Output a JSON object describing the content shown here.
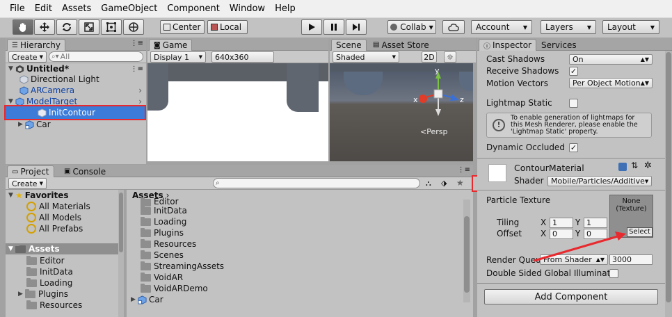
{
  "menu": [
    "File",
    "Edit",
    "Assets",
    "GameObject",
    "Component",
    "Window",
    "Help"
  ],
  "toolbar": {
    "pivot": "Center",
    "space": "Local",
    "collab": "Collab",
    "account": "Account",
    "layers": "Layers",
    "layout": "Layout"
  },
  "hierarchy": {
    "tab": "Hierarchy",
    "create": "Create",
    "search_placeholder": "All",
    "scene": "Untitled*",
    "items": [
      "Directional Light",
      "ARCamera",
      "ModelTarget",
      "InitContour",
      "Car"
    ]
  },
  "game": {
    "tab": "Game",
    "display": "Display 1",
    "resolution": "640x360"
  },
  "scene_view": {
    "tab": "Scene",
    "asset_store": "Asset Store",
    "shading": "Shaded",
    "mode2d": "2D",
    "persp": "Persp",
    "axes": [
      "y",
      "x",
      "z"
    ]
  },
  "project": {
    "tab": "Project",
    "console": "Console",
    "create": "Create",
    "favorites": "Favorites",
    "favorite_items": [
      "All Materials",
      "All Models",
      "All Prefabs"
    ],
    "assets": "Assets",
    "asset_folders": [
      "Editor",
      "InitData",
      "Loading",
      "Plugins",
      "Resources"
    ],
    "breadcrumb": "Assets",
    "files": [
      "Editor",
      "InitData",
      "Loading",
      "Plugins",
      "Resources",
      "Scenes",
      "StreamingAssets",
      "VoidAR",
      "VoidARDemo",
      "Car"
    ]
  },
  "inspector": {
    "tab": "Inspector",
    "services": "Services",
    "cast_shadows_label": "Cast Shadows",
    "cast_shadows_value": "On",
    "receive_shadows": "Receive Shadows",
    "motion_vectors_label": "Motion Vectors",
    "motion_vectors_value": "Per Object Motion",
    "lightmap_static": "Lightmap Static",
    "lightmap_info": "To enable generation of lightmaps for this Mesh Renderer, please enable the 'Lightmap Static' property.",
    "dynamic_occluded": "Dynamic Occluded",
    "material_name": "ContourMaterial",
    "shader_label": "Shader",
    "shader_value": "Mobile/Particles/Additive",
    "particle_texture": "Particle Texture",
    "texture_none": "None",
    "texture_type": "(Texture)",
    "select": "Select",
    "tiling": "Tiling",
    "offset": "Offset",
    "tiling_x": "1",
    "tiling_y": "1",
    "offset_x": "0",
    "offset_y": "0",
    "x_label": "X",
    "y_label": "Y",
    "render_queue_label": "Render Queu",
    "render_queue_mode": "From Shader",
    "render_queue_value": "3000",
    "double_sided": "Double Sided Global Illuminati",
    "add_component": "Add Component"
  },
  "colors": {
    "selection": "#3d7bd9",
    "highlight_red": "#e8292e"
  }
}
